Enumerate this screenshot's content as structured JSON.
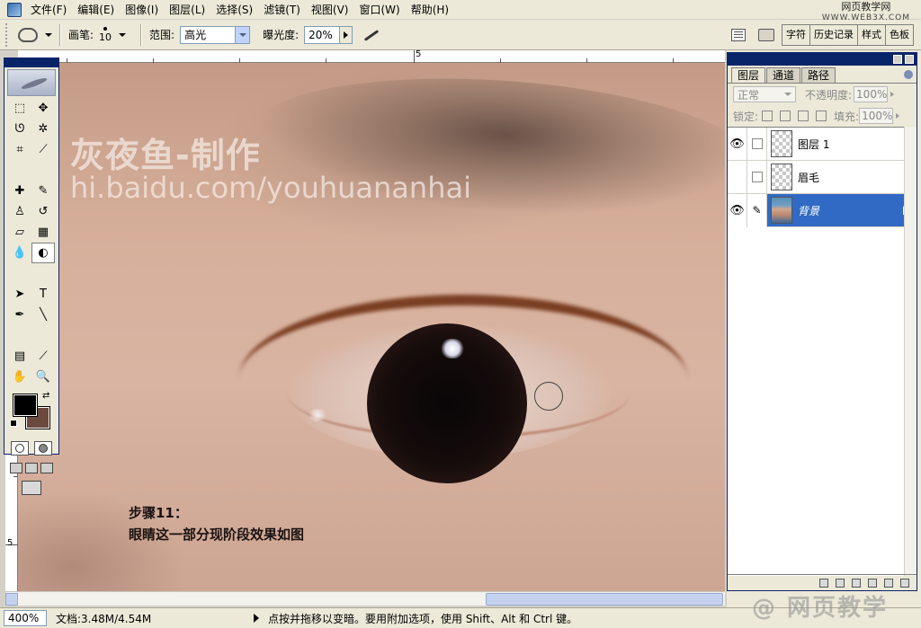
{
  "menubar": {
    "items": [
      "文件(F)",
      "编辑(E)",
      "图像(I)",
      "图层(L)",
      "选择(S)",
      "滤镜(T)",
      "视图(V)",
      "窗口(W)",
      "帮助(H)"
    ],
    "site_watermark": "网页教学网",
    "site_watermark_sub": "WWW.WEB3X.COM"
  },
  "options_bar": {
    "brush_label": "画笔:",
    "brush_size": "10",
    "range_label": "范围:",
    "range_value": "高光",
    "exposure_label": "曝光度:",
    "exposure_value": "20%",
    "wells": [
      "字符",
      "历史记录",
      "样式",
      "色板"
    ]
  },
  "ruler": {
    "h_mark": "5",
    "v_mark": "5"
  },
  "canvas": {
    "watermark_title": "灰夜鱼-制作",
    "watermark_url": "hi.baidu.com/youhuananhai",
    "caption_line1": "步骤11：",
    "caption_line2": "眼睛这一部分现阶段效果如图"
  },
  "colors": {
    "foreground": "#000000",
    "background": "#6b4a3d",
    "selection": "#316ac5"
  },
  "layers_panel": {
    "tabs": [
      "图层",
      "通道",
      "路径"
    ],
    "blend_mode": "正常",
    "opacity_label": "不透明度:",
    "opacity_value": "100%",
    "lock_label": "锁定:",
    "fill_label": "填充:",
    "fill_value": "100%",
    "layers": [
      {
        "name": "图层 1",
        "visible": true,
        "selected": false
      },
      {
        "name": "眉毛",
        "visible": false,
        "selected": false
      },
      {
        "name": "背景",
        "visible": true,
        "selected": true,
        "locked": true
      }
    ]
  },
  "statusbar": {
    "zoom": "400%",
    "doc_size": "文档:3.48M/4.54M",
    "hint": "点按并拖移以变暗。要用附加选项，使用 Shift、Alt 和 Ctrl 键。"
  }
}
